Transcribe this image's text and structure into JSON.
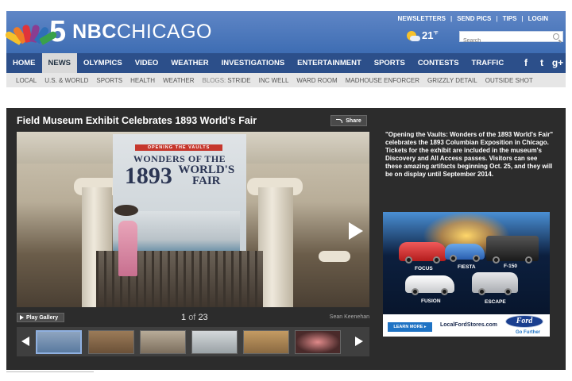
{
  "header": {
    "channel_number": "5",
    "brand_bold": "NBC",
    "brand_light": "CHICAGO",
    "top_links": [
      "NEWSLETTERS",
      "SEND PICS",
      "TIPS",
      "LOGIN"
    ],
    "weather_temp": "21",
    "weather_unit": "°F",
    "search_placeholder": "Search",
    "peacock_colors": [
      "#f6c12b",
      "#ef7c26",
      "#e0343a",
      "#8a3d91",
      "#2f6fb7",
      "#3aa14a"
    ]
  },
  "nav": {
    "items": [
      "HOME",
      "NEWS",
      "OLYMPICS",
      "VIDEO",
      "WEATHER",
      "INVESTIGATIONS",
      "ENTERTAINMENT",
      "SPORTS",
      "CONTESTS",
      "TRAFFIC"
    ],
    "active": "NEWS",
    "social": [
      "facebook-icon",
      "twitter-icon",
      "google-plus-icon"
    ]
  },
  "subnav": {
    "items": [
      "LOCAL",
      "U.S. & WORLD",
      "SPORTS",
      "HEALTH",
      "WEATHER"
    ],
    "blogs_label": "BLOGS:",
    "blogs": [
      "STRIDE",
      "INC WELL",
      "WARD ROOM",
      "MADHOUSE ENFORCER",
      "GRIZZLY DETAIL",
      "OUTSIDE SHOT"
    ]
  },
  "gallery": {
    "title": "Field Museum Exhibit Celebrates 1893 World's Fair",
    "share_label": "Share",
    "banner_top": "OPENING THE VAULTS",
    "banner_line1": "WONDERS OF THE",
    "banner_year": "1893",
    "banner_line2a": "WORLD'S",
    "banner_line2b": "FAIR",
    "play_label": "Play Gallery",
    "current": "1",
    "of_label": "of",
    "total": "23",
    "credit": "Sean Keenehan",
    "description": "\"Opening the Vaults: Wonders of the 1893 World's Fair\" celebrates the 1893 Columbian Exposition in Chicago. Tickets for the exhibit are included in the museum's Discovery and All Access passes. Visitors can see these amazing artifacts beginning Oct. 25, and they will be on display until September 2014.",
    "thumb_colors": [
      "#5a7aa0",
      "#6b5138",
      "#7d6f5e",
      "#9aa2a6",
      "#8a6a42",
      "#4a2a2a"
    ]
  },
  "ad": {
    "models": [
      "FOCUS",
      "FIESTA",
      "F-150",
      "FUSION",
      "ESCAPE"
    ],
    "learn_more": "LEARN MORE ▸",
    "site": "LocalFordStores.com",
    "brand": "Ford",
    "tagline": "Go Further"
  }
}
